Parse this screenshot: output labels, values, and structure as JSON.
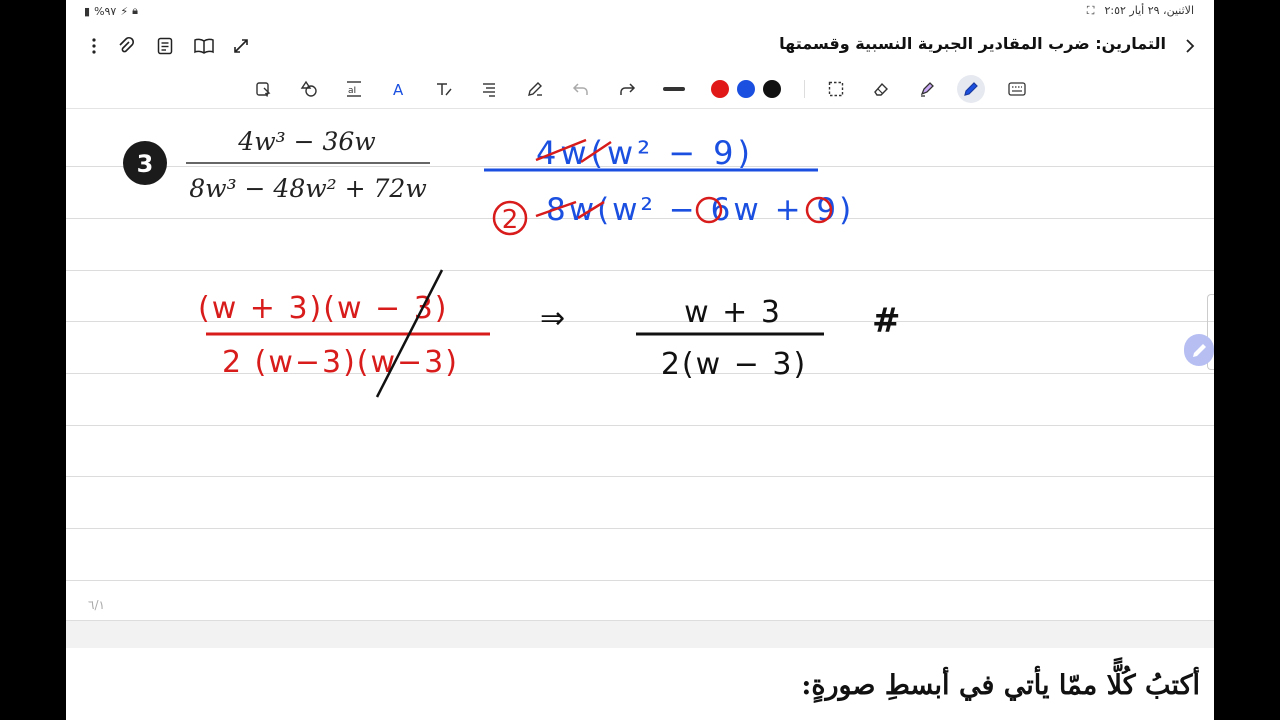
{
  "status": {
    "battery": "%٩٧",
    "datetime": "الاثنين، ٢٩ أيار ٢:٥٢"
  },
  "header": {
    "title": "التمارين: ضرب المقادير الجبرية النسبية وقسمتها"
  },
  "toolbar": {
    "colors": [
      "#e01818",
      "#1a4fe0",
      "#111111"
    ]
  },
  "exercise": {
    "number": "3",
    "numerator": "4w³ − 36w",
    "denominator": "8w³ − 48w² + 72w"
  },
  "handwriting": {
    "blue_top": "4w(w² − 9)",
    "blue_bottom": "8w(w² − 6w + 9)",
    "circled_two": "2",
    "red_num": "(w + 3)(w − 3)",
    "red_den": "2 (w−3)(w−3)",
    "implies": "⇒",
    "result_num": "w + 3",
    "result_den": "2(w − 3)",
    "final_mark": "#"
  },
  "footer": {
    "page_indicator": "٦/١",
    "next_page_text": "أكتبُ كُلًّا ممّا يأتي في أبسطِ صورةٍ:"
  }
}
